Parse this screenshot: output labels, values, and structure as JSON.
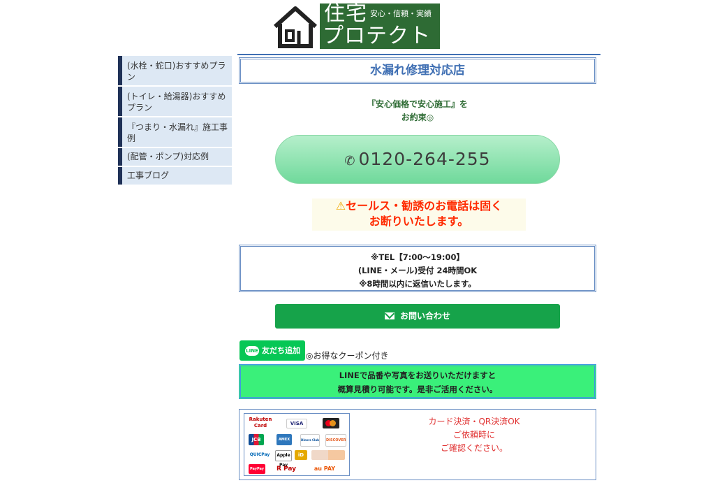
{
  "header": {
    "logo_line1": "住宅",
    "logo_tagline": "安心・信頼・実績",
    "logo_line2": "プロテクト"
  },
  "sidebar": {
    "items": [
      {
        "label": "(水栓・蛇口)おすすめプラン"
      },
      {
        "label": "(トイレ・給湯器)おすすめプラン"
      },
      {
        "label": "『つまり・水漏れ』施工事例"
      },
      {
        "label": "(配管・ポンプ)対応例"
      },
      {
        "label": "工事ブログ"
      }
    ]
  },
  "main": {
    "title": "水漏れ修理対応店",
    "promise_line1": "『安心価格で安心施工』を",
    "promise_line2": "お約束◎",
    "phone": "0120-264-255",
    "warning_line1": "セールス・勧誘のお電話は固く",
    "warning_line2": "お断りいたします。",
    "hours_line1": "※TEL【7:00～19:00】",
    "hours_line2": "(LINE・メール)受付 24時間OK",
    "hours_line3": "※8時間以内に返信いたします。",
    "contact_label": "お問い合わせ",
    "line_badge": "LINE",
    "line_button_label": "友だち追加",
    "coupon_text": "◎お得なクーポン付き",
    "line_note_line1": "LINEで品番や写真をお送りいただけますと",
    "line_note_line2": "概算見積り可能です。是非ご活用ください。",
    "payment_line1": "カード決済・QR決済OK",
    "payment_line2": "ご依頼時に",
    "payment_line3": "ご確認ください。",
    "payment_logos": [
      "Rakuten Card",
      "VISA",
      "JCB",
      "AMEX",
      "Diners Club",
      "DISCOVER",
      "QUICPay",
      "Apple Pay",
      "iD",
      "PayPay",
      "R Pay",
      "au PAY"
    ]
  },
  "colors": {
    "accent_blue": "#3f6fb3",
    "sidebar_bg": "#dde8f4",
    "line_green": "#06c755",
    "contact_green": "#16a34a",
    "warning_red": "#ff2a00"
  }
}
